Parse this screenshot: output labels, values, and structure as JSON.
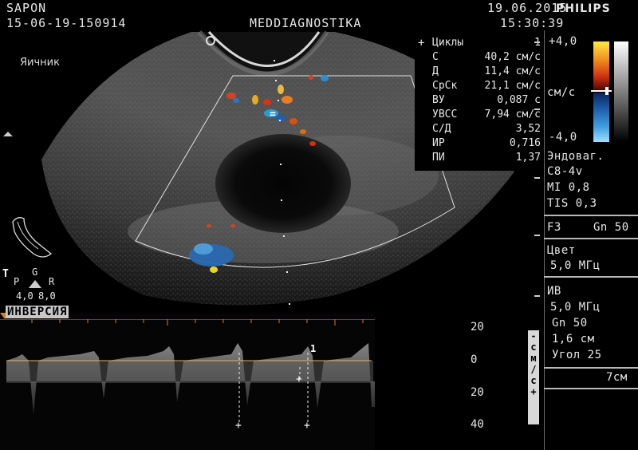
{
  "header": {
    "patient": "SAPON",
    "exam_id": "15-06-19-150914",
    "institution": "MEDDIAGNOSTIKA",
    "date": "19.06.2015",
    "time": "15:30:39",
    "brand": "PHILIPS"
  },
  "image": {
    "organ_label": "Яичник",
    "gate_marker": "=",
    "sv_marker": "1"
  },
  "measurements": {
    "marker": "+",
    "rows": [
      {
        "label": "Циклы",
        "value": "1"
      },
      {
        "label": "С",
        "value": "40,2 см/с"
      },
      {
        "label": "Д",
        "value": "11,4 см/с"
      },
      {
        "label": "СрСк",
        "value": "21,1 см/с"
      },
      {
        "label": "ВУ",
        "value": "0,087 с"
      },
      {
        "label": "УВСС",
        "value": "7,94 см/с"
      },
      {
        "label": "С/Д",
        "value": "3,52"
      },
      {
        "label": "ИР",
        "value": "0,716"
      },
      {
        "label": "ПИ",
        "value": "1,37"
      }
    ]
  },
  "color_scale": {
    "top": "+4,0",
    "unit": "см/с",
    "bottom": "-4,0"
  },
  "right_panel": {
    "probe_mode": "Эндоваг.",
    "probe": "C8-4v",
    "mi": "MI 0,8",
    "tis": "TIS 0,3",
    "focus": "F3",
    "gain": "Gn 50",
    "color_title": "Цвет",
    "color_freq": "5,0 МГц",
    "pw_title": "ИВ",
    "pw_freq": "5,0 МГц",
    "pw_gain": "Gn 50",
    "pw_gate": "1,6 см",
    "pw_angle": "Угол 25",
    "depth": "7см"
  },
  "orientation": {
    "p": "P",
    "g": "G",
    "r": "R",
    "f1": "4,0",
    "f2": "8,0"
  },
  "spectral": {
    "invert_label": "ИНВЕРСИЯ",
    "axis_ticks": [
      "20",
      "0",
      "20",
      "40"
    ],
    "axis_unit": "- с м / с +"
  }
}
